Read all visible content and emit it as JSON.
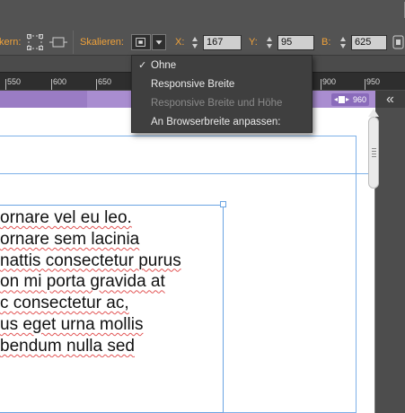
{
  "control_bar": {
    "ankern_label": "kern:",
    "skalieren_label": "Skalieren:",
    "x_label": "X:",
    "x_value": "167",
    "y_label": "Y:",
    "y_value": "95",
    "b_label": "B:",
    "b_value": "625",
    "accent_color": "#f0a23a"
  },
  "ruler": {
    "ticks": [
      "550",
      "600",
      "650",
      "900",
      "950"
    ]
  },
  "breakpoint": {
    "value": "960"
  },
  "scale_menu": {
    "items": [
      {
        "label": "Ohne",
        "checked": true,
        "enabled": true
      },
      {
        "label": "Responsive Breite",
        "checked": false,
        "enabled": true
      },
      {
        "label": "Responsive Breite und Höhe",
        "checked": false,
        "enabled": false
      },
      {
        "label": "An Browserbreite anpassen:",
        "checked": false,
        "enabled": true
      }
    ]
  },
  "text_frame": {
    "lines": [
      "ornare vel eu leo.",
      " ornare sem lacinia",
      "nattis consectetur purus",
      "on mi porta gravida at",
      "c consectetur ac,",
      "us eget urna mollis",
      "bendum nulla sed"
    ]
  }
}
